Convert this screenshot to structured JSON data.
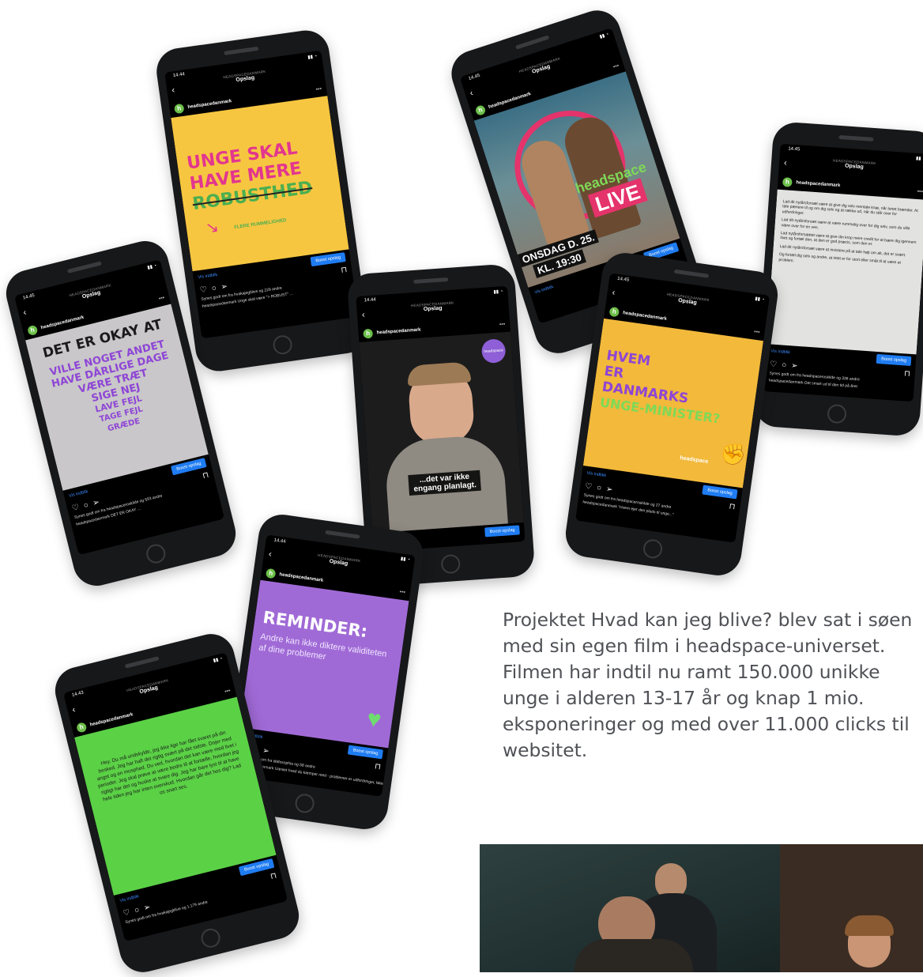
{
  "app": {
    "header_sub": "HEADSPACEDANMARK",
    "header_title": "Opslag",
    "account": "headspacedanmark",
    "vis_indblik": "Vis indblik",
    "boost": "Boost opslag",
    "icons": [
      "heart-icon",
      "comment-icon",
      "send-icon",
      "bookmark-icon"
    ]
  },
  "phones": {
    "p1": {
      "time": "14.44",
      "sub_account": "Sponsoreret",
      "lines": [
        "UNGE SKAL",
        "HAVE MERE",
        "ROBUSTHED"
      ],
      "arrow_text": "FLERE RUMMELIGHED",
      "likes": "Synes godt om fra hvakajegblive og 229 andre",
      "caption": "headspacedanmark Unge skal være \"> ROBUST\" ..."
    },
    "p2": {
      "time": "14.45",
      "lines": [
        "DET ER OKAY AT",
        "VILLE NOGET ANDET",
        "HAVE DÅRLIGE DAGE",
        "VÆRE TRÆT",
        "SIGE NEJ",
        "LAVE FEJL",
        "TAGE FEJL",
        "GRÆDE"
      ],
      "likes": "Synes godt om fra headspaceroskilde og 593 andre",
      "caption": "headspacedanmark DET ER OKAY ..."
    },
    "p3": {
      "time": "14.45",
      "live_brand": "headspace",
      "live_word": "LIVE",
      "date": "ONSDAG D. 25.",
      "clock": "KL. 19:30"
    },
    "p4": {
      "time": "14.44",
      "subtitle_1": "...det var ikke",
      "subtitle_2": "engang planlagt.",
      "brand_badge": "headspace"
    },
    "p5": {
      "time": "14.45",
      "lines": [
        "HVEM",
        "ER",
        "DANMARKS",
        "UNGE-MINISTER?"
      ],
      "logo": "headspace",
      "likes": "Synes godt om fra headspaceroskilde og 27 andre",
      "caption": "headspacedanmark \"Hvem ejer den plads til unge...\""
    },
    "p6": {
      "time": "14.45",
      "text_1": "Lad dit nytårsforsæt være at give dig selv mentale knæ, når lortet brænder. At tale pænere til og om dig selv og at række ud, når du står over for udfordringer.",
      "text_2": "Lad dit nytårsforsæt være at være rummelig over for dig selv, som du ville være over for en ven.",
      "text_3": "Lad nytårsforsættet være at give din krop mere credit for at bære dig igennem livet og fortæl den, at den er god præcis, som den er.",
      "text_4": "Lad dit nytårsforsæt være at insistere på at tale højt om alt, det er svært.",
      "text_5": "Og fortæl dig selv og andre, at intet er for stort eller småt til at være et problem.",
      "likes": "Synes godt om fra headspaceroskilde og 336 andre",
      "caption": "headspacedanmark Det smart ud til den tid på året"
    },
    "p7": {
      "time": "14.44",
      "title": "REMINDER:",
      "body": "Andre kan ikke diktere validiteten af dine problemer",
      "likes": "Synes godt om fra idafosophia og 58 andre",
      "caption": "headspacedanmark Uanset hvad du kæmper med - problemer er udfordringer, føles relevant"
    },
    "p8": {
      "time": "14.43",
      "body": "Hey. Du må undskylde, jeg ikke lige har fået svaret på din besked. Jeg har haft det rigtig svært på det sidste. Dojer med angst og en mosphed. Du ved, hvordan det kan være med livet i perioder. Jeg skal prøve at være bedre til at fortælle, hvordan jeg rigtigt har det og huske at svare dig. Jeg har bare lyst til at have hele tiden jeg har inten overskud. Hvordan går det hos dig? Lad os snart ses.",
      "likes": "Synes godt om fra hvakajegblive og 1.179 andre"
    }
  },
  "body_text": "Projektet Hvad kan jeg blive? blev sat i søen med sin egen film i headspace-universet. Filmen har indtil nu ramt 150.000 unikke unge i alderen 13-17 år og knap 1 mio. eksponeringer og med over 11.000 clicks til websitet."
}
